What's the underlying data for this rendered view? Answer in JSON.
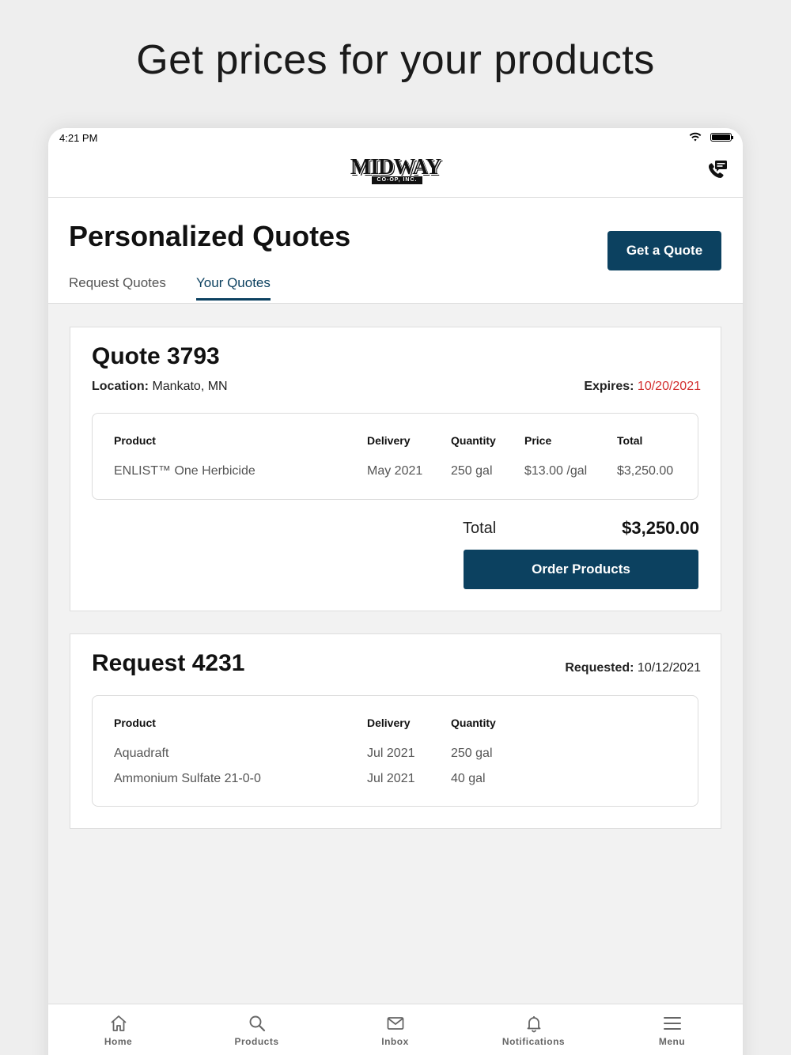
{
  "headline": "Get prices for your products",
  "statusbar": {
    "time": "4:21 PM"
  },
  "navbar": {
    "logo_text": "MIDWAY",
    "logo_sub": "CO-OP, INC."
  },
  "page": {
    "title": "Personalized Quotes",
    "get_quote_label": "Get a Quote",
    "tabs": [
      {
        "label": "Request Quotes",
        "active": false
      },
      {
        "label": "Your Quotes",
        "active": true
      }
    ]
  },
  "quote": {
    "title": "Quote 3793",
    "location_label": "Location:",
    "location_value": "Mankato, MN",
    "expires_label": "Expires:",
    "expires_value": "10/20/2021",
    "columns": [
      "Product",
      "Delivery",
      "Quantity",
      "Price",
      "Total"
    ],
    "rows": [
      {
        "product": "ENLIST™ One Herbicide",
        "delivery": "May 2021",
        "quantity": "250 gal",
        "price": "$13.00 /gal",
        "total": "$3,250.00"
      }
    ],
    "total_label": "Total",
    "total_value": "$3,250.00",
    "order_label": "Order Products"
  },
  "request": {
    "title": "Request 4231",
    "requested_label": "Requested:",
    "requested_value": "10/12/2021",
    "columns": [
      "Product",
      "Delivery",
      "Quantity"
    ],
    "rows": [
      {
        "product": "Aquadraft",
        "delivery": "Jul 2021",
        "quantity": "250 gal"
      },
      {
        "product": "Ammonium Sulfate 21-0-0",
        "delivery": "Jul 2021",
        "quantity": "40 gal"
      }
    ]
  },
  "tabbar": {
    "items": [
      {
        "label": "Home",
        "icon": "home-icon"
      },
      {
        "label": "Products",
        "icon": "search-icon"
      },
      {
        "label": "Inbox",
        "icon": "mail-icon"
      },
      {
        "label": "Notifications",
        "icon": "bell-icon"
      },
      {
        "label": "Menu",
        "icon": "hamburger-icon"
      }
    ]
  },
  "colors": {
    "brand": "#0c4160",
    "expires": "#d32f2f"
  }
}
